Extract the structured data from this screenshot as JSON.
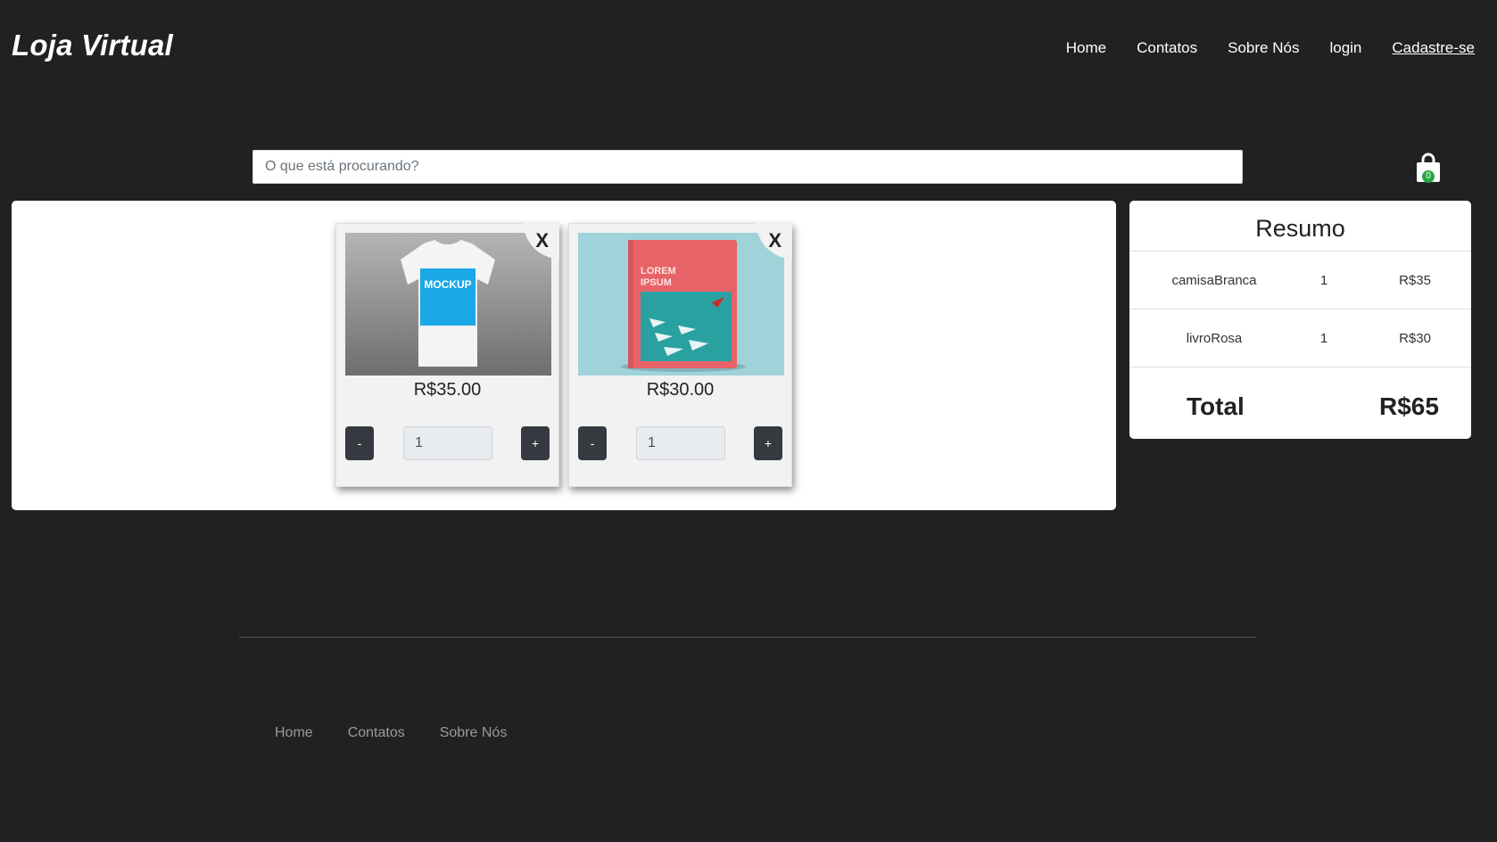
{
  "header": {
    "logo": "Loja Virtual",
    "nav": [
      "Home",
      "Contatos",
      "Sobre Nós",
      "login",
      "Cadastre-se"
    ]
  },
  "search": {
    "placeholder": "O que está procurando?",
    "value": ""
  },
  "cart": {
    "count": "0",
    "icon": "shopping-bag-icon",
    "badge_color": "#28a745"
  },
  "products": [
    {
      "image": "t-shirt-mockup",
      "image_text": "MOCKUP",
      "price": "R$35.00",
      "quantity": "1",
      "close": "X",
      "minus": "-",
      "plus": "+"
    },
    {
      "image": "book-cover",
      "image_text": "LOREM IPSUM",
      "price": "R$30.00",
      "quantity": "1",
      "close": "X",
      "minus": "-",
      "plus": "+"
    }
  ],
  "summary": {
    "title": "Resumo",
    "rows": [
      {
        "name": "camisaBranca",
        "qty": "1",
        "price": "R$35"
      },
      {
        "name": "livroRosa",
        "qty": "1",
        "price": "R$30"
      }
    ],
    "total_label": "Total",
    "total_value": "R$65"
  },
  "footer": {
    "nav": [
      "Home",
      "Contatos",
      "Sobre Nós"
    ]
  },
  "colors": {
    "background": "#212121",
    "button_dark": "#343a40"
  }
}
